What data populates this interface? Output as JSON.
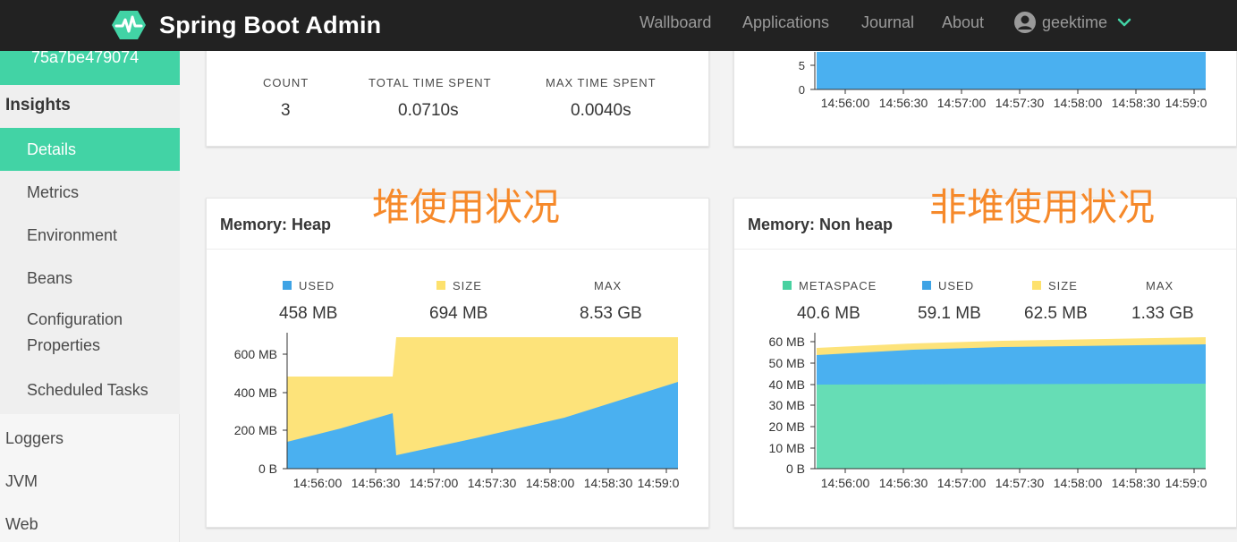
{
  "navbar": {
    "title": "Spring Boot Admin",
    "logo_icon": "heartbeat-hexagon-icon",
    "items": [
      "Wallboard",
      "Applications",
      "Journal",
      "About"
    ],
    "user": "geektime"
  },
  "sidebar": {
    "instance_id": "75a7be479074",
    "groups": {
      "insights": "Insights",
      "loggers": "Loggers",
      "jvm": "JVM",
      "web": "Web"
    },
    "items": {
      "details": "Details",
      "metrics": "Metrics",
      "environment": "Environment",
      "beans": "Beans",
      "config_line1": "Configuration",
      "config_line2": "Properties",
      "scheduled": "Scheduled Tasks"
    }
  },
  "top_left_card": {
    "stats": [
      {
        "label": "COUNT",
        "value": "3"
      },
      {
        "label": "TOTAL TIME SPENT",
        "value": "0.0710s"
      },
      {
        "label": "MAX TIME SPENT",
        "value": "0.0040s"
      }
    ]
  },
  "top_right_chart": {
    "y_ticks": [
      "5",
      "0"
    ],
    "x_ticks": [
      "14:56:00",
      "14:56:30",
      "14:57:00",
      "14:57:30",
      "14:58:00",
      "14:58:30",
      "14:59:0"
    ]
  },
  "annotations": {
    "heap": "堆使用状况",
    "nonheap": "非堆使用状况"
  },
  "heap": {
    "title": "Memory: Heap",
    "legend": [
      {
        "name": "USED",
        "value": "458 MB",
        "color": "#3ea3e5"
      },
      {
        "name": "SIZE",
        "value": "694 MB",
        "color": "#fde16d"
      },
      {
        "name": "MAX",
        "value": "8.53 GB",
        "color": ""
      }
    ],
    "y_ticks": [
      "600 MB",
      "400 MB",
      "200 MB",
      "0 B"
    ],
    "x_ticks": [
      "14:56:00",
      "14:56:30",
      "14:57:00",
      "14:57:30",
      "14:58:00",
      "14:58:30",
      "14:59:0"
    ]
  },
  "nonheap": {
    "title": "Memory: Non heap",
    "legend": [
      {
        "name": "METASPACE",
        "value": "40.6 MB",
        "color": "#48d1a0"
      },
      {
        "name": "USED",
        "value": "59.1 MB",
        "color": "#3ea3e5"
      },
      {
        "name": "SIZE",
        "value": "62.5 MB",
        "color": "#fde16d"
      },
      {
        "name": "MAX",
        "value": "1.33 GB",
        "color": ""
      }
    ],
    "y_ticks": [
      "60 MB",
      "50 MB",
      "40 MB",
      "30 MB",
      "20 MB",
      "10 MB",
      "0 B"
    ],
    "x_ticks": [
      "14:56:00",
      "14:56:30",
      "14:57:00",
      "14:57:30",
      "14:58:00",
      "14:58:30",
      "14:59:0"
    ]
  },
  "colors": {
    "accent": "#42d3a5",
    "used": "#4ab0f0",
    "size": "#fde37a",
    "metaspace": "#66ddb5",
    "navbar": "#222222",
    "annotation": "#f6892a"
  }
}
